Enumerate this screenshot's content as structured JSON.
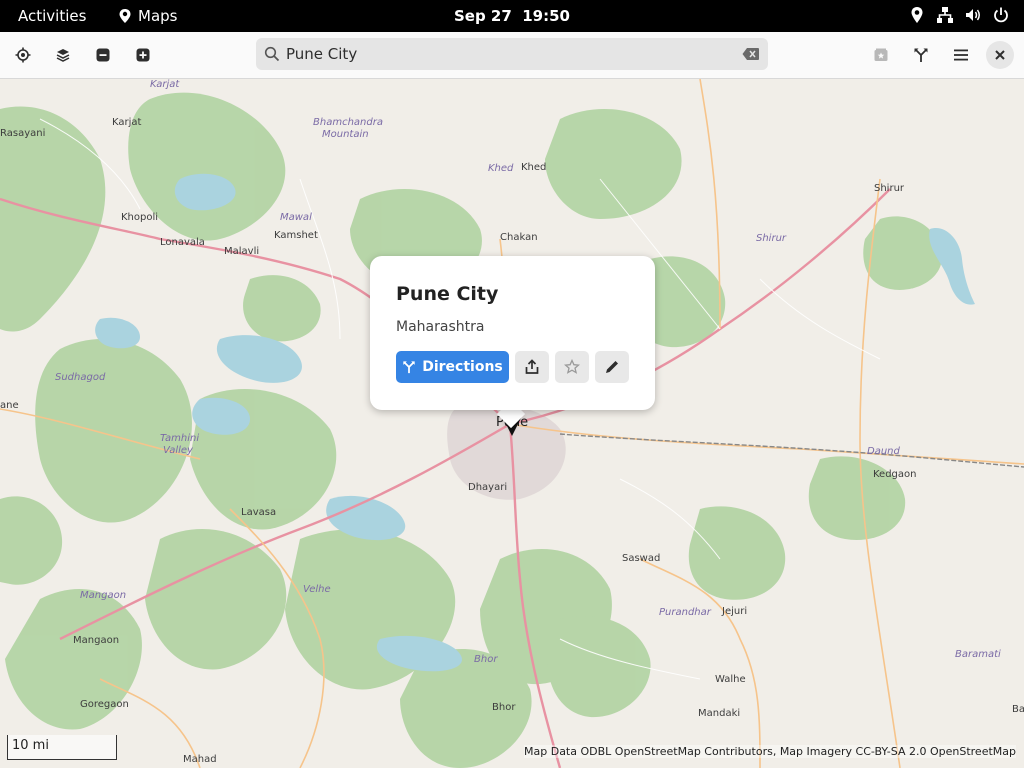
{
  "topbar": {
    "activities": "Activities",
    "app_name": "Maps",
    "clock": "Sep 27  19:50"
  },
  "search": {
    "value": "Pune City",
    "placeholder": ""
  },
  "popover": {
    "title": "Pune City",
    "subtitle": "Maharashtra",
    "directions_label": "Directions"
  },
  "map": {
    "labels": {
      "karjat_i": "Karjat",
      "rasayani": "Rasayani",
      "karjat": "Karjat",
      "bhamchandra": "Bhamchandra",
      "mountain": "Mountain",
      "khed_i": "Khed",
      "khed": "Khed",
      "shirur": "Shirur",
      "shirur_i": "Shirur",
      "khopoli": "Khopoli",
      "lonavala": "Lonavala",
      "malavli": "Malavli",
      "kamshet": "Kamshet",
      "mawal": "Mawal",
      "chakan": "Chakan",
      "sudhagod": "Sudhagod",
      "pane": "ane",
      "tamhini": "Tamhini",
      "valley": "Valley",
      "pune": "Pune",
      "dhayari": "Dhayari",
      "daund": "Daund",
      "kedgaon": "Kedgaon",
      "lavasa": "Lavasa",
      "saswad": "Saswad",
      "velhe": "Velhe",
      "mangaon_i": "Mangaon",
      "mangaon": "Mangaon",
      "purandhar": "Purandhar",
      "jejuri": "Jejuri",
      "baramati": "Baramati",
      "bhor_i": "Bhor",
      "goregaon": "Goregaon",
      "walhe": "Walhe",
      "bhor": "Bhor",
      "mandaki": "Mandaki",
      "mahad": "Mahad",
      "ba": "Ba"
    },
    "scale": "10 mi",
    "attribution": "Map Data ODBL OpenStreetMap Contributors, Map Imagery CC-BY-SA 2.0 OpenStreetMap"
  },
  "icons": {
    "locate": "crosshair-icon",
    "layers": "layers-icon",
    "zoom_out": "zoom-out-icon",
    "zoom_in": "zoom-in-icon",
    "favorites": "favorites-icon",
    "route": "route-icon",
    "menu": "hamburger-menu-icon",
    "close": "close-icon"
  },
  "colors": {
    "accent": "#3584e4",
    "forest": "#add19e",
    "water": "#aad3df",
    "land": "#f1eee8",
    "road_major": "#e892a2",
    "road_secondary": "#f6c48b"
  }
}
